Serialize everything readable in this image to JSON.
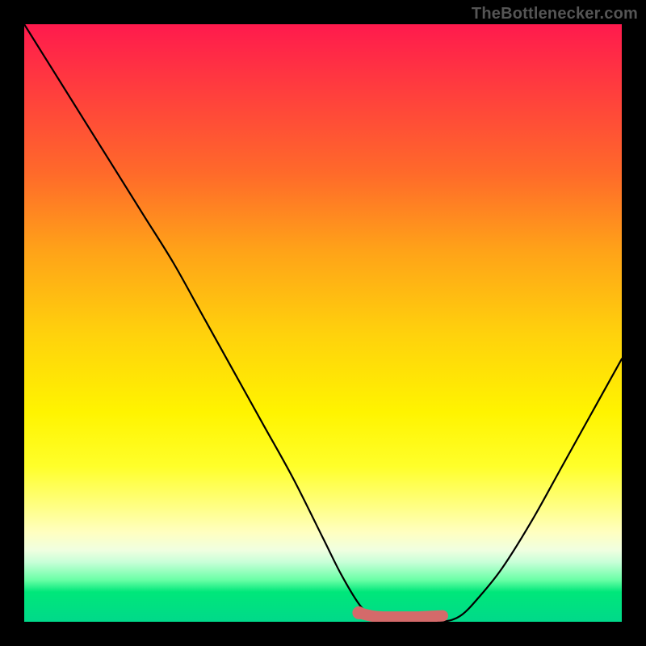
{
  "watermark": "TheBottlenecker.com",
  "colors": {
    "background": "#000000",
    "gradient_top": "#ff1a4d",
    "gradient_bottom": "#00d98a",
    "curve": "#000000",
    "sweet_spot": "#d46a6a"
  },
  "chart_data": {
    "type": "line",
    "title": "",
    "xlabel": "",
    "ylabel": "",
    "xlim": [
      0,
      100
    ],
    "ylim": [
      0,
      100
    ],
    "series": [
      {
        "name": "bottleneck-curve",
        "x": [
          0,
          5,
          10,
          15,
          20,
          25,
          30,
          35,
          40,
          45,
          50,
          53,
          56,
          58,
          60,
          63,
          66,
          70,
          73,
          76,
          80,
          85,
          90,
          95,
          100
        ],
        "values": [
          100,
          92,
          84,
          76,
          68,
          60,
          51,
          42,
          33,
          24,
          14,
          8,
          3,
          1,
          0,
          0,
          0,
          0,
          1,
          4,
          9,
          17,
          26,
          35,
          44
        ]
      },
      {
        "name": "sweet-spot",
        "x": [
          56,
          58,
          60,
          63,
          66,
          70
        ],
        "values": [
          1.5,
          1.0,
          0.8,
          0.8,
          0.8,
          1.0
        ]
      }
    ]
  }
}
